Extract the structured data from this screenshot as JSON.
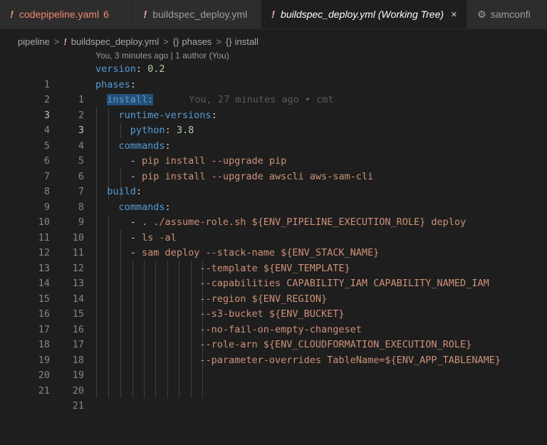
{
  "tabs": [
    {
      "icon": "!",
      "label": "codepipeline.yaml",
      "count": "6"
    },
    {
      "icon": "!",
      "label": "buildspec_deploy.yml"
    },
    {
      "icon": "!",
      "label": "buildspec_deploy.yml (Working Tree)",
      "close": "×"
    },
    {
      "icon": "⚙",
      "label": "samconfi"
    }
  ],
  "breadcrumb": {
    "folder": "pipeline",
    "file_icon": "!",
    "file": "buildspec_deploy.yml",
    "brace1": "{}",
    "item1": "phases",
    "brace2": "{}",
    "item2": "install",
    "sep": ">"
  },
  "codelens": "You, 3 minutes ago | 1 author (You)",
  "blame": "You, 27 minutes ago • cmt",
  "lines": [
    {
      "a": "1",
      "b": "1"
    },
    {
      "a": "2",
      "b": "2"
    },
    {
      "a": "3",
      "b": "3"
    },
    {
      "a": "4",
      "b": "4"
    },
    {
      "a": "5",
      "b": "5"
    },
    {
      "a": "6",
      "b": "6"
    },
    {
      "a": "7",
      "b": "7"
    },
    {
      "a": "8",
      "b": "8"
    },
    {
      "a": "9",
      "b": "9"
    },
    {
      "a": "10",
      "b": "10"
    },
    {
      "a": "11",
      "b": "11"
    },
    {
      "a": "12",
      "b": "12"
    },
    {
      "a": "13",
      "b": "13"
    },
    {
      "a": "14",
      "b": "14"
    },
    {
      "a": "15",
      "b": "15"
    },
    {
      "a": "16",
      "b": "16"
    },
    {
      "a": "17",
      "b": "17"
    },
    {
      "a": "18",
      "b": "18"
    },
    {
      "a": "19",
      "b": "19"
    },
    {
      "a": "20",
      "b": "20"
    },
    {
      "a": "21",
      "b": "21"
    }
  ],
  "code": {
    "l1_key": "version",
    "l1_colon": ": ",
    "l1_val": "0.2",
    "l2_key": "phases",
    "l2_colon": ":",
    "l3_key": "install:",
    "l4_key": "runtime-versions",
    "l4_colon": ":",
    "l5_key": "python",
    "l5_colon": ": ",
    "l5_val": "3.8",
    "l6_key": "commands",
    "l6_colon": ":",
    "l7_dash": "- ",
    "l7_val": "pip install --upgrade pip",
    "l8_dash": "- ",
    "l8_val": "pip install --upgrade awscli aws-sam-cli",
    "l9_key": "build",
    "l9_colon": ":",
    "l10_key": "commands",
    "l10_colon": ":",
    "l11_dash": "- ",
    "l11_val": ". ./assume-role.sh ${ENV_PIPELINE_EXECUTION_ROLE} deploy",
    "l12_dash": "- ",
    "l12_val": "ls -al",
    "l13_dash": "- ",
    "l13_val": "sam deploy --stack-name ${ENV_STACK_NAME}",
    "l14": "--template ${ENV_TEMPLATE}",
    "l15": "--capabilities CAPABILITY_IAM CAPABILITY_NAMED_IAM",
    "l16": "--region ${ENV_REGION}",
    "l17": "--s3-bucket ${ENV_BUCKET}",
    "l18": "--no-fail-on-empty-changeset",
    "l19": "--role-arn ${ENV_CLOUDFORMATION_EXECUTION_ROLE}",
    "l20": "--parameter-overrides TableName=${ENV_APP_TABLENAME}"
  }
}
